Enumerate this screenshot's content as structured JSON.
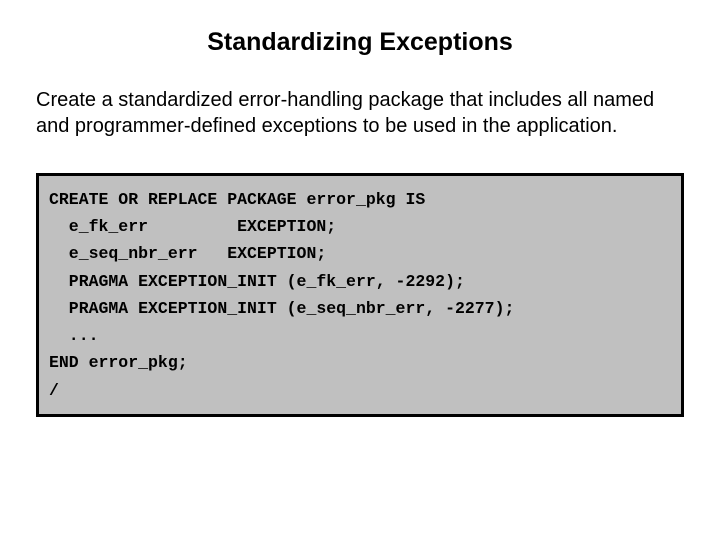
{
  "title": "Standardizing Exceptions",
  "body": "Create a standardized error-handling package that includes all named and programmer-defined exceptions to be used in the application.",
  "code": {
    "line1": "CREATE OR REPLACE PACKAGE error_pkg IS",
    "line2": "  e_fk_err         EXCEPTION;",
    "line3": "  e_seq_nbr_err   EXCEPTION;",
    "line4": "  PRAGMA EXCEPTION_INIT (e_fk_err, -2292);",
    "line5": "  PRAGMA EXCEPTION_INIT (e_seq_nbr_err, -2277);",
    "line6": "  ...",
    "line7": "END error_pkg;",
    "line8": "/"
  }
}
